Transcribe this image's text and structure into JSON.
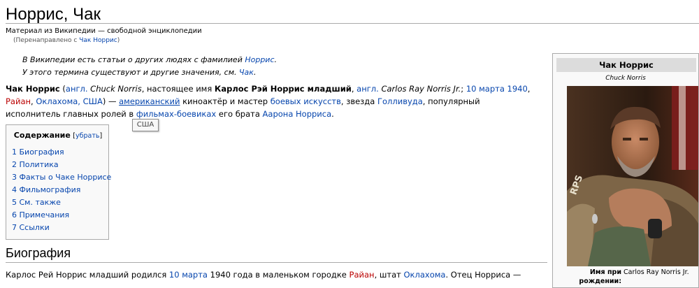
{
  "article": {
    "title": "Норрис, Чак",
    "site_sub": "Материал из Википедии — свободной энциклопедии",
    "redirect_prefix": "(Перенаправлено с ",
    "redirect_link": "Чак Норрис",
    "redirect_suffix": ")"
  },
  "hatnotes": {
    "line1_text": "В Википедии есть статьи о других людях с фамилией ",
    "line1_link": "Норрис",
    "line1_end": ".",
    "line2_text": "У этого термина существуют и другие значения, см. ",
    "line2_link": "Чак",
    "line2_end": "."
  },
  "lead": {
    "name": "Чак Норрис",
    "s1": " (",
    "angl1": "англ.",
    "s2": " ",
    "name_en": "Chuck Norris",
    "s3": ", настоящее имя ",
    "full_name": "Карлос Рэй Норрис младший",
    "s4": ", ",
    "angl2": "англ.",
    "s5": " ",
    "full_name_en": "Carlos Ray Norris Jr.",
    "s6": "; ",
    "birth_date": "10 марта 1940",
    "s7": ", ",
    "birth_town": "Райан",
    "s8": ", ",
    "birth_state": "Оклахома, США",
    "s9": ") — ",
    "nationality": "американский",
    "s10": " киноактёр и мастер ",
    "martial_arts": "боевых искусств",
    "s11": ", звезда ",
    "hollywood": "Голливуда",
    "s12": ", популярный исполнитель главных ролей в ",
    "action_films": "фильмах-боевиках",
    "s13": " его брата ",
    "brother": "Аарона Норриса",
    "s14": "."
  },
  "tooltip": {
    "text": "США"
  },
  "toc": {
    "title": "Содержание",
    "toggle_open": "[",
    "toggle_label": "убрать",
    "toggle_close": "]",
    "items": [
      {
        "label": "1 Биография"
      },
      {
        "label": "2 Политика"
      },
      {
        "label": "3 Факты о Чаке Норрисе"
      },
      {
        "label": "4 Фильмография"
      },
      {
        "label": "5 См. также"
      },
      {
        "label": "6 Примечания"
      },
      {
        "label": "7 Ссылки"
      }
    ]
  },
  "section": {
    "heading": "Биография"
  },
  "bio": {
    "t1": "Карлос Рей Норрис младший родился ",
    "date": "10 марта",
    "t2": " 1940 года в маленьком городке ",
    "town": "Райан",
    "t3": ", штат ",
    "state": "Оклахома",
    "t4": ". Отец Норриса —"
  },
  "infobox": {
    "title": "Чак Норрис",
    "subtitle": "Chuck Norris",
    "birth_label": "Имя при рождении:",
    "birth_value": "Carlos Ray Norris Jr."
  },
  "colors": {
    "link": "#0645ad",
    "new_link": "#ba0000",
    "infobox_header": "#dcdcdc"
  }
}
